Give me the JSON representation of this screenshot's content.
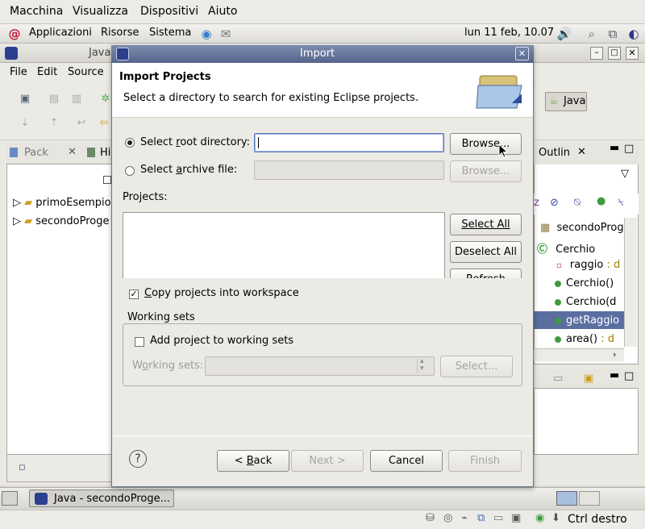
{
  "vm_menu": [
    "Macchina",
    "Visualizza",
    "Dispositivi",
    "Aiuto"
  ],
  "panel": {
    "applications": "Applicazioni",
    "places": "Risorse",
    "system": "Sistema",
    "clock": "lun 11 feb, 10.07"
  },
  "eclipse": {
    "title": "Java",
    "menu": [
      "File",
      "Edit",
      "Source"
    ],
    "perspective": "Java",
    "left_tabs": [
      "Pack",
      "Hi"
    ],
    "tree": [
      "primoEsempio",
      "secondoProge"
    ],
    "outline_tab": "Outlin",
    "outline_items": [
      {
        "label": "secondoProg",
        "kind": "package-icon"
      },
      {
        "label": "Cerchio",
        "kind": "class-icon"
      },
      {
        "label": "raggio",
        "suffix": " : d",
        "kind": "field-icon"
      },
      {
        "label": "Cerchio()",
        "kind": "constructor-icon"
      },
      {
        "label": "Cerchio(d",
        "kind": "constructor-icon"
      },
      {
        "label": "getRaggio",
        "kind": "method-icon"
      },
      {
        "label": "area()",
        "suffix": " : d",
        "kind": "method-icon"
      }
    ]
  },
  "taskbar": {
    "window_title": "Java - secondoProge..."
  },
  "vm_status": {
    "host_key": "Ctrl destro"
  },
  "dialog": {
    "title": "Import",
    "header_title": "Import Projects",
    "header_desc": "Select a directory to search for existing Eclipse projects.",
    "root_label_pre": "Select ",
    "root_label_ul": "r",
    "root_label_post": "oot directory:",
    "archive_label_pre": "Select ",
    "archive_label_ul": "a",
    "archive_label_post": "rchive file:",
    "root_value": "",
    "archive_value": "",
    "browse_label": "Browse...",
    "browse2_label": "Browse...",
    "projects_label": "Projects:",
    "select_all_label": "Select All",
    "deselect_all_label": "Deselect All",
    "refresh_label": "Refresh",
    "copy_label_pre": "",
    "copy_label_ul": "C",
    "copy_label_post": "opy projects into workspace",
    "copy_checked": true,
    "working_sets_group": "Working sets",
    "add_ws_label": "Add project to working sets",
    "ws_label_pre": "W",
    "ws_label_ul": "o",
    "ws_label_post": "rking sets:",
    "ws_select_label": "Select...",
    "back_label_pre": "< ",
    "back_label_ul": "B",
    "back_label_post": "ack",
    "next_label": "Next >",
    "cancel_label": "Cancel",
    "finish_label": "Finish"
  }
}
